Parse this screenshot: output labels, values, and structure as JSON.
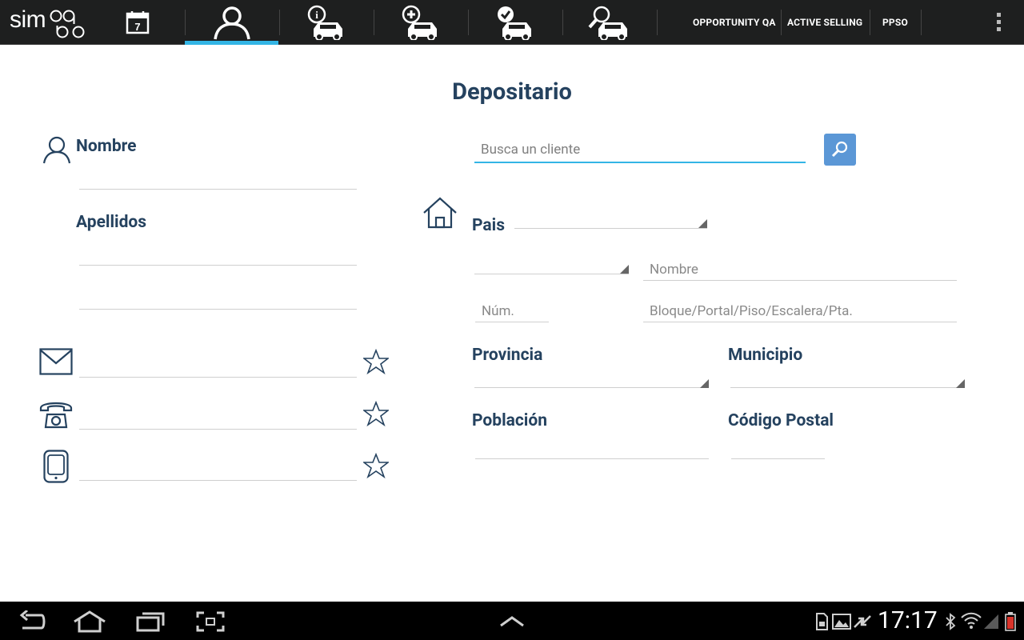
{
  "app": {
    "logo_text": "simgo",
    "menu": [
      "OPPORTUNITY QA",
      "ACTIVE SELLING",
      "PPSO"
    ]
  },
  "nav_icons": [
    "calendar-icon",
    "user-icon",
    "car-info-icon",
    "car-add-icon",
    "car-check-icon",
    "car-search-icon"
  ],
  "calendar_day": "7",
  "form": {
    "title": "Depositario",
    "nombre_label": "Nombre",
    "apellidos_label": "Apellidos",
    "search_placeholder": "Busca un cliente",
    "pais_label": "Pais",
    "street_name_placeholder": "Nombre",
    "num_placeholder": "Núm.",
    "bloque_placeholder": "Bloque/Portal/Piso/Escalera/Pta.",
    "provincia_label": "Provincia",
    "municipio_label": "Municipio",
    "poblacion_label": "Población",
    "codigo_postal_label": "Código Postal"
  },
  "status": {
    "time": "17:17"
  },
  "colors": {
    "accent": "#33b5e5",
    "heading": "#25425f",
    "search_button": "#5b97d6"
  }
}
